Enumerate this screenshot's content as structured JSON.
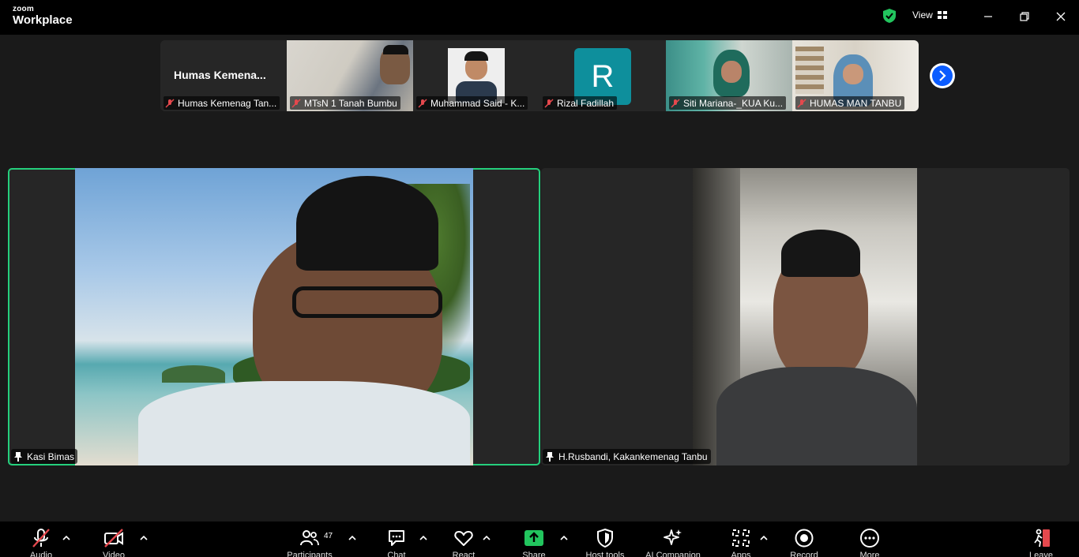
{
  "app": {
    "logo_line1": "zoom",
    "logo_line2": "Workplace",
    "view_label": "View",
    "accent": "#25d07d"
  },
  "filmstrip": [
    {
      "name": "Humas Kemenag Tan...",
      "big_label": "Humas  Kemena...",
      "type": "name-only"
    },
    {
      "name": "MTsN 1 Tanah Bumbu",
      "type": "video"
    },
    {
      "name": "Muhammad Said - K...",
      "type": "video"
    },
    {
      "name": "Rizal Fadillah",
      "type": "avatar",
      "avatar_letter": "R",
      "avatar_color": "#0e8f9c"
    },
    {
      "name": "Siti Mariana-_KUA Ku...",
      "type": "video"
    },
    {
      "name": "HUMAS MAN TANBU",
      "type": "video"
    }
  ],
  "speakers": [
    {
      "name": "Kasi Bimas",
      "active": true
    },
    {
      "name": "H.Rusbandi, Kakankemenag Tanbu",
      "active": false
    }
  ],
  "toolbar": {
    "audio": "Audio",
    "video": "Video",
    "participants": "Participants",
    "participants_count": "47",
    "chat": "Chat",
    "react": "React",
    "share": "Share",
    "host_tools": "Host tools",
    "ai_companion": "AI Companion",
    "apps": "Apps",
    "record": "Record",
    "more": "More",
    "leave": "Leave"
  },
  "icons": [
    "security-shield-icon",
    "view-grid-icon",
    "minimize-icon",
    "restore-icon",
    "close-icon",
    "mic-muted-icon",
    "next-page-icon",
    "pin-icon",
    "audio-muted-icon",
    "video-off-icon",
    "participants-icon",
    "chat-icon",
    "heart-icon",
    "share-up-icon",
    "shield-host-icon",
    "sparkle-icon",
    "apps-icon",
    "record-icon",
    "more-icon",
    "leave-icon",
    "caret-up-icon"
  ]
}
